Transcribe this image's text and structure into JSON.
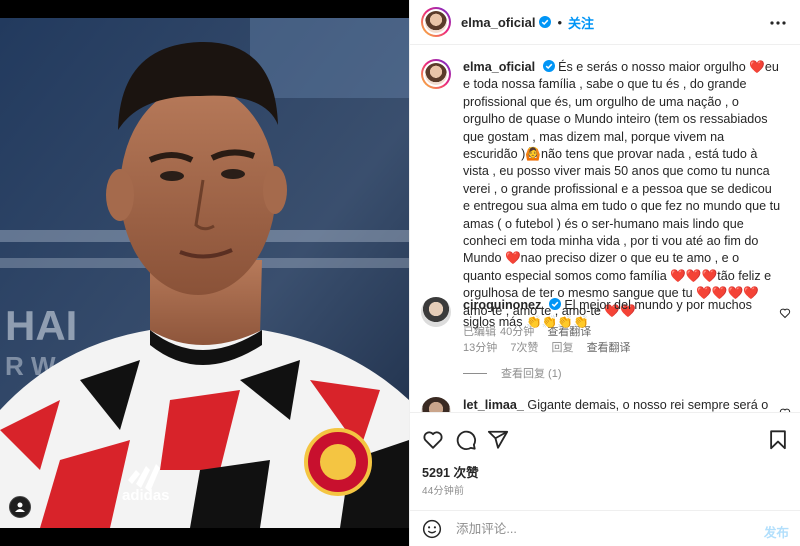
{
  "post": {
    "author": "elma_oficial",
    "follow_label": "关注",
    "caption_text": "És e serás o nosso maior orgulho ❤️eu e toda nossa família , sabe o que tu és , do grande profissional que és, um orgulho de uma nação , o orgulho de quase o Mundo inteiro (tem os ressabiados que gostam , mas dizem mal, porque vivem na escuridão )🙆não tens que provar nada , está tudo à vista , eu posso viver mais 50 anos que como tu nunca verei , o grande profissional e a pessoa que se dedicou e entregou sua alma em tudo o que fez no mundo que tu amas ( o futebol ) és o ser-humano mais lindo que conheci em toda minha vida , por ti vou até ao fim do Mundo ❤️nao preciso dizer o que eu te amo , e o quanto especial somos como família ❤️❤️❤️tão feliz e orgulhosa de ter o mesmo sangue que tu ❤️❤️❤️❤️amo-te , amo te , amo-te ❤️❤️",
    "caption_meta": {
      "edited": "已编辑",
      "age": "40分钟",
      "translate": "查看翻译"
    }
  },
  "comments": [
    {
      "user": "ciroquinonez",
      "text": "El mejor del mundo y por muchos siglos más 👏👏👏👏",
      "age": "13分钟",
      "likes": "7次赞",
      "reply": "回复",
      "translate": "查看翻译",
      "view_replies": "查看回复 (1)"
    },
    {
      "user": "let_limaa_",
      "text": "Gigante demais, o nosso rei sempre será o"
    }
  ],
  "actions": {
    "likes_count": "5291 次赞",
    "time_ago": "44分钟前",
    "icons": [
      "heart-icon",
      "comment-icon",
      "share-icon",
      "bookmark-icon"
    ]
  },
  "add_comment": {
    "placeholder": "添加评论...",
    "post_label": "发布"
  },
  "colors": {
    "link": "#0095f6",
    "heart": "#e3262c",
    "muted": "#8e8e8e",
    "post_disabled": "#b2dffc"
  }
}
